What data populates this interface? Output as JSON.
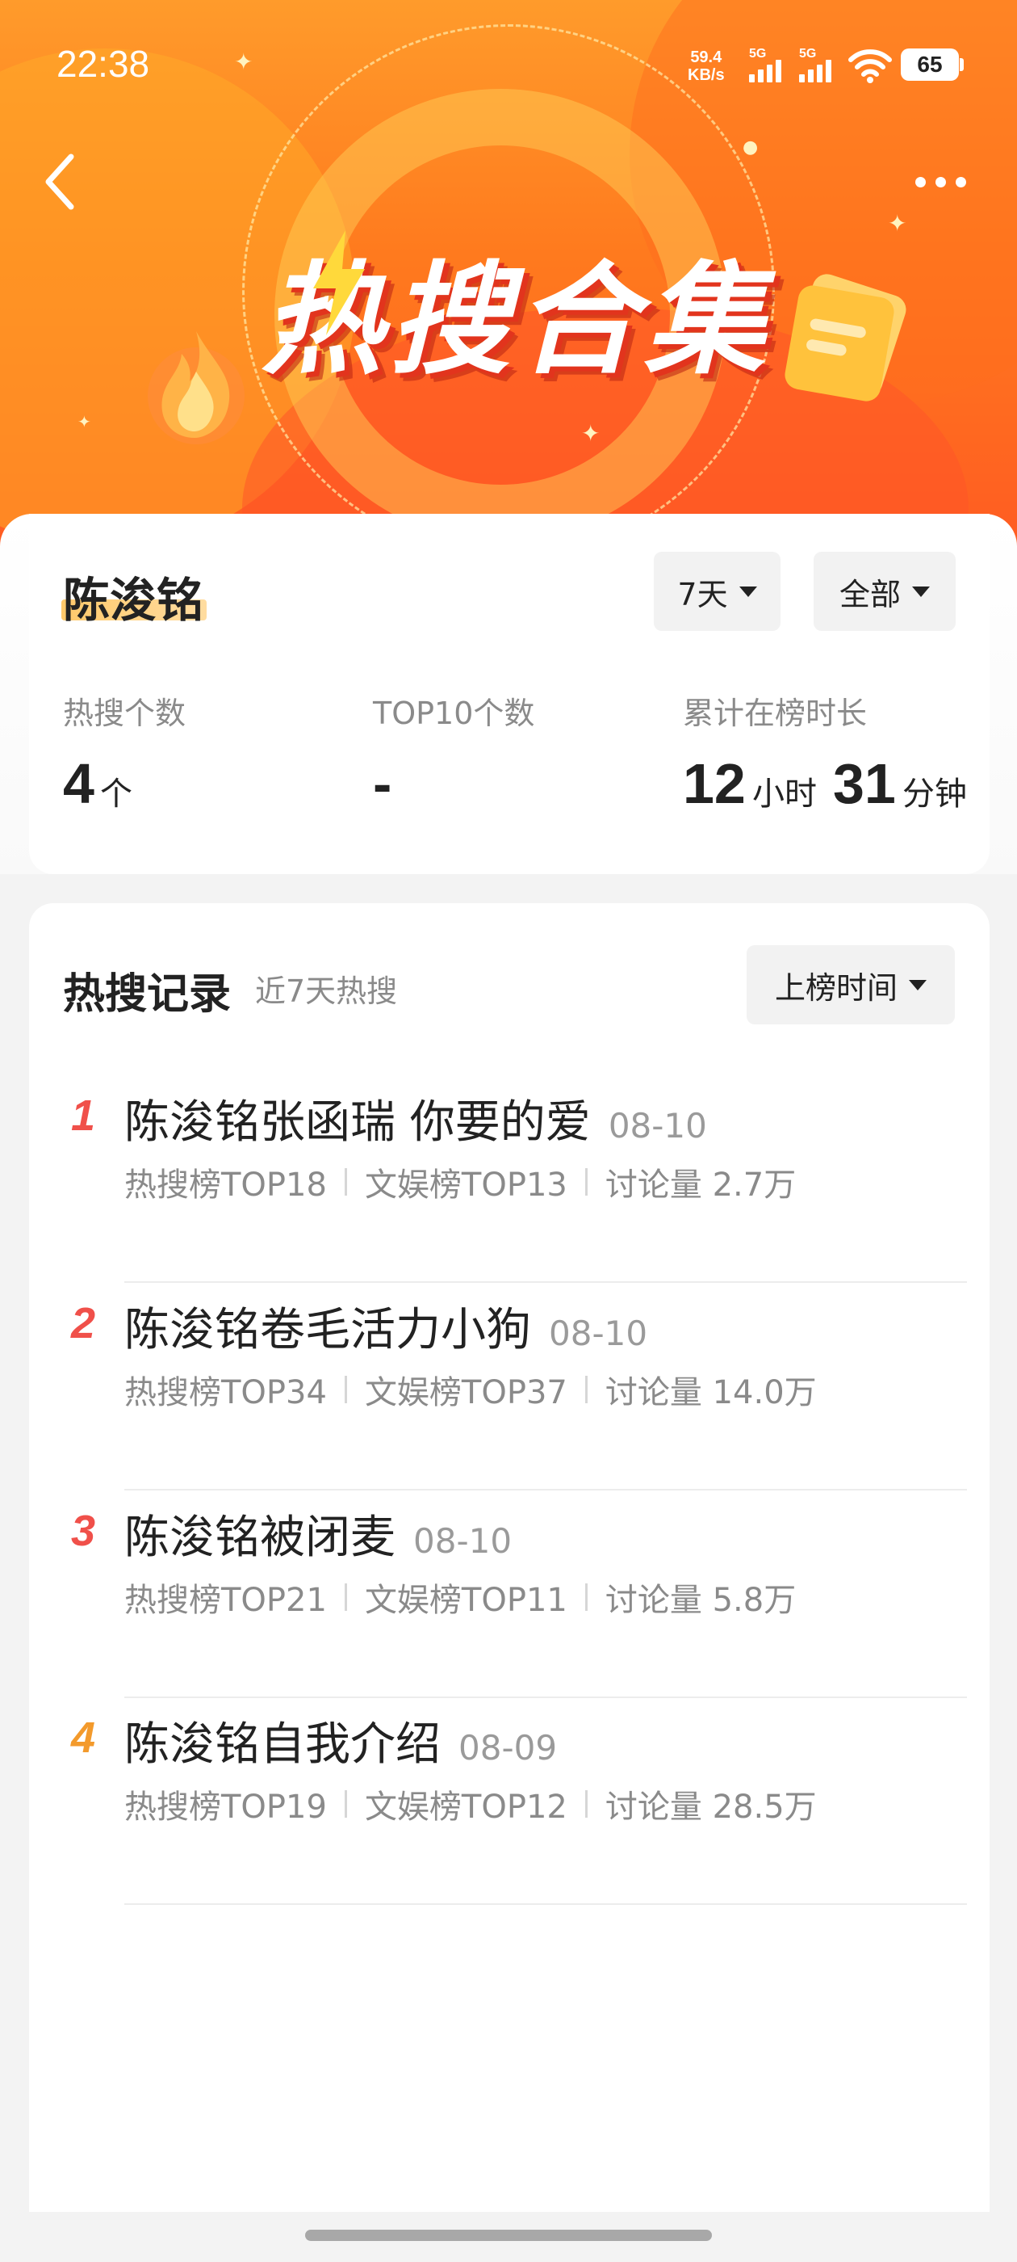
{
  "status_bar": {
    "time": "22:38",
    "net_speed_value": "59.4",
    "net_speed_unit": "KB/s",
    "sim1_label": "5G",
    "sim2_label": "5G",
    "battery": "65"
  },
  "header": {
    "banner_title": "热搜合集",
    "back_icon": "chevron-left-icon",
    "more_icon": "more-dots-icon"
  },
  "summary": {
    "name": "陈浚铭",
    "period_filter": "7天",
    "scope_filter": "全部",
    "stats": {
      "hot_count_label": "热搜个数",
      "hot_count_value": "4",
      "hot_count_unit": "个",
      "top10_label": "TOP10个数",
      "top10_value": "-",
      "duration_label": "累计在榜时长",
      "duration_hours": "12",
      "hours_unit": "小时",
      "duration_minutes": "31",
      "minutes_unit": "分钟"
    }
  },
  "records": {
    "title": "热搜记录",
    "subtitle": "近7天热搜",
    "sort_label": "上榜时间",
    "items": [
      {
        "rank": "1",
        "title": "陈浚铭张函瑞 你要的爱",
        "date": "08-10",
        "hot_rank": "热搜榜TOP18",
        "ent_rank": "文娱榜TOP13",
        "discussion": "讨论量 2.7万"
      },
      {
        "rank": "2",
        "title": "陈浚铭卷毛活力小狗",
        "date": "08-10",
        "hot_rank": "热搜榜TOP34",
        "ent_rank": "文娱榜TOP37",
        "discussion": "讨论量 14.0万"
      },
      {
        "rank": "3",
        "title": "陈浚铭被闭麦",
        "date": "08-10",
        "hot_rank": "热搜榜TOP21",
        "ent_rank": "文娱榜TOP11",
        "discussion": "讨论量 5.8万"
      },
      {
        "rank": "4",
        "title": "陈浚铭自我介绍",
        "date": "08-09",
        "hot_rank": "热搜榜TOP19",
        "ent_rank": "文娱榜TOP12",
        "discussion": "讨论量 28.5万"
      }
    ]
  },
  "colors": {
    "rank_top3": "#f0504a",
    "rank_other": "#f39a2c",
    "hero_orange": "#ff7a1e"
  }
}
